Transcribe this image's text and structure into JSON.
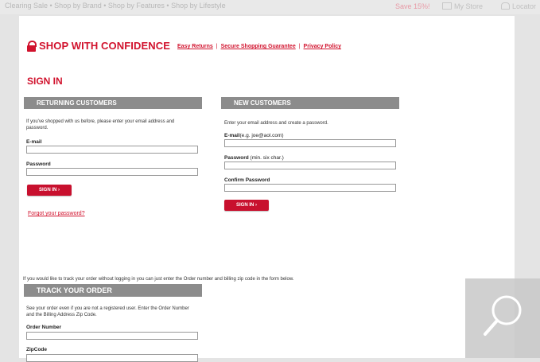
{
  "topbar": {
    "faint_text": "Clearing Sale  •  Shop by Brand  •  Shop by Features  •  Shop by Lifestyle",
    "save_label": "Save 15%!",
    "my_store_label": "My Store",
    "locator_label": "Locator"
  },
  "confidence": {
    "title": "SHOP WITH CONFIDENCE",
    "links": [
      "Easy Returns",
      "Secure Shopping Guarantee",
      "Privacy Policy"
    ],
    "separator": "|"
  },
  "signin": {
    "heading": "SIGN IN"
  },
  "returning": {
    "header": "RETURNING CUSTOMERS",
    "intro": "If you've shopped with us before, please enter your email address and password.",
    "email_label": "E-mail",
    "password_label": "Password",
    "button_label": "SIGN IN ›",
    "forgot_label": "Forgot your password?"
  },
  "new_customers": {
    "header": "NEW CUSTOMERS",
    "intro": "Enter your email address and create a password.",
    "email_label": "E-mail",
    "email_hint": "(e.g. joe@aol.com)",
    "password_label": "Password",
    "password_hint": "(min. six char.)",
    "confirm_label": "Confirm Password",
    "button_label": "SIGN IN ›"
  },
  "track": {
    "note": "If you would like to track your order without logging in you can just enter the Order number and billing zip code in the form below.",
    "header": "TRACK YOUR ORDER",
    "intro": "See your order even if you are not a registered user.  Enter the Order Number and the Billing Address Zip Code.",
    "order_label": "Order Number",
    "zip_label": "ZipCode"
  },
  "icons": {
    "lock": "lock-icon",
    "zoom": "magnifier-icon"
  },
  "colors": {
    "brand_red": "#d1122d",
    "header_gray": "#8c8c8c",
    "button_red": "#c8102e"
  }
}
